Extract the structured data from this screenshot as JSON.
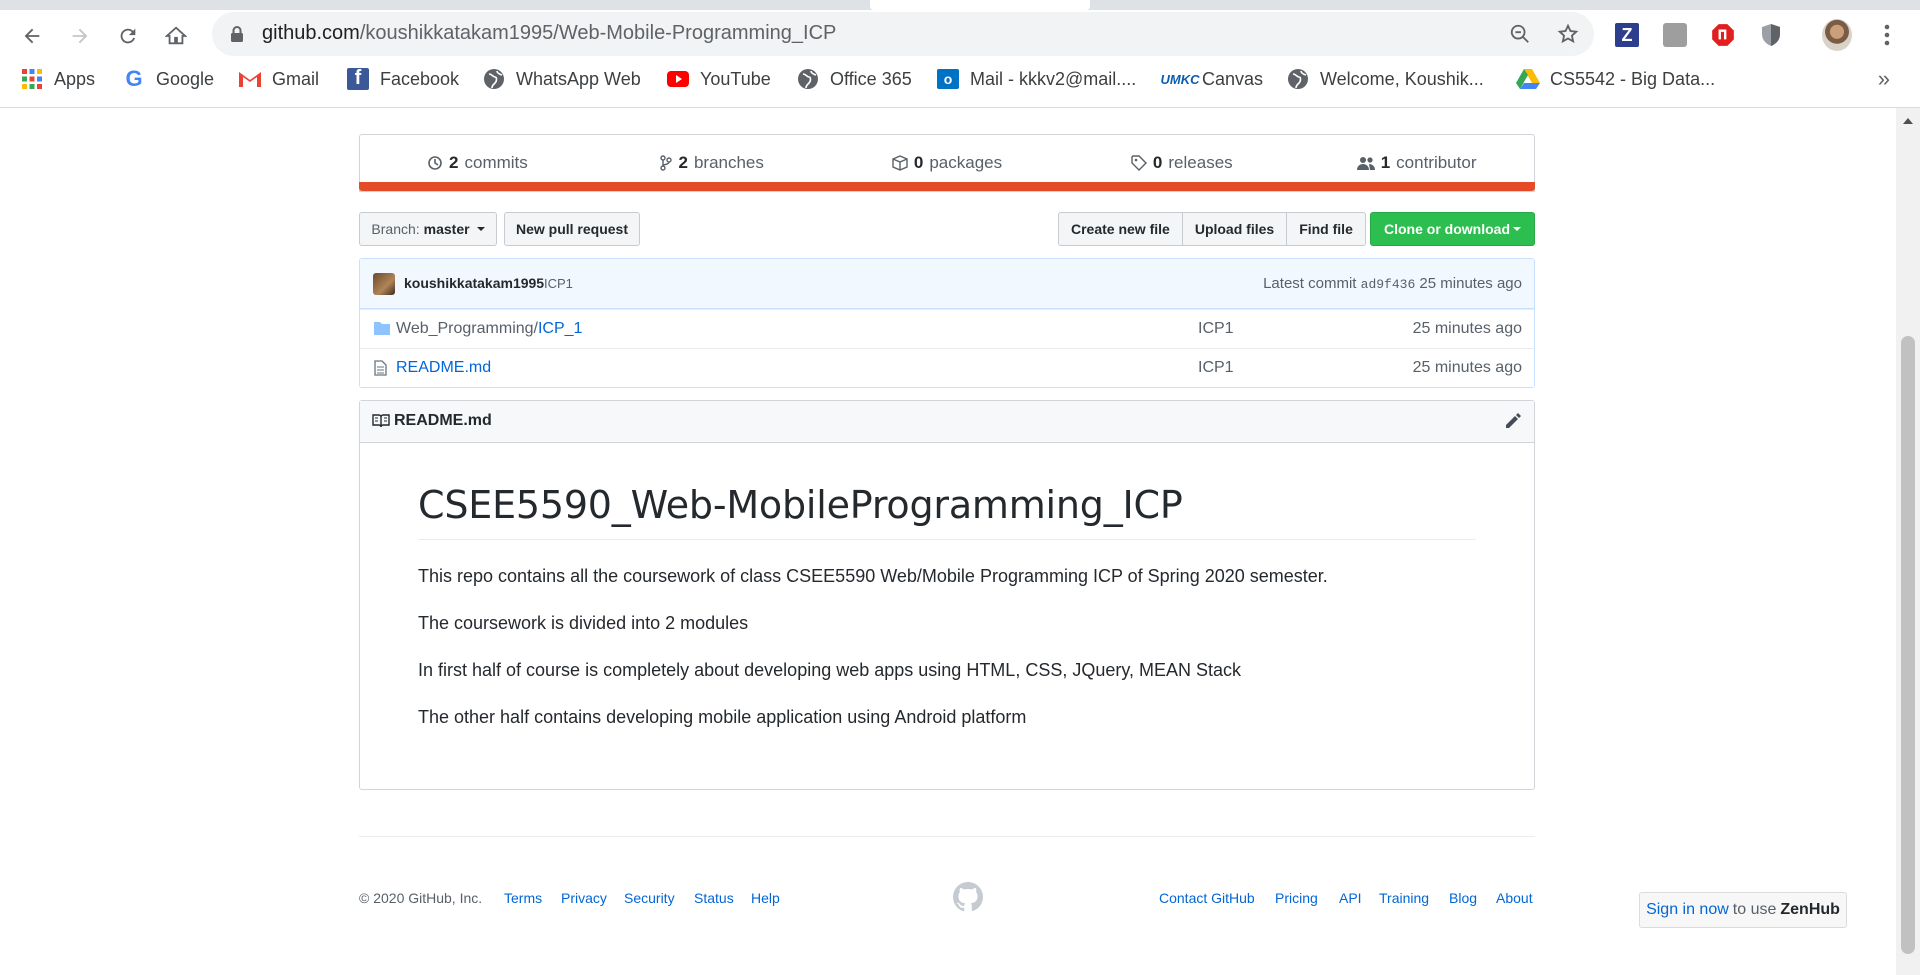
{
  "browser": {
    "url_domain": "github.com",
    "url_path": "/koushikkatakam1995/Web-Mobile-Programming_ICP",
    "bookmarks": [
      {
        "label": "Apps",
        "icon": "apps-grid-icon"
      },
      {
        "label": "Google",
        "icon": "google-icon"
      },
      {
        "label": "Gmail",
        "icon": "gmail-icon"
      },
      {
        "label": "Facebook",
        "icon": "facebook-icon"
      },
      {
        "label": "WhatsApp Web",
        "icon": "globe-icon"
      },
      {
        "label": "YouTube",
        "icon": "youtube-icon"
      },
      {
        "label": "Office 365",
        "icon": "globe-icon"
      },
      {
        "label": "Mail - kkkv2@mail....",
        "icon": "outlook-icon"
      },
      {
        "label": "Canvas",
        "icon": "umkc-icon"
      },
      {
        "label": "Welcome, Koushik...",
        "icon": "globe-icon"
      },
      {
        "label": "CS5542 - Big Data...",
        "icon": "google-drive-icon"
      }
    ],
    "bookmarks_overflow": "»"
  },
  "repo": {
    "numbers": [
      {
        "count": "2",
        "label": "commits"
      },
      {
        "count": "2",
        "label": "branches"
      },
      {
        "count": "0",
        "label": "packages"
      },
      {
        "count": "0",
        "label": "releases"
      },
      {
        "count": "1",
        "label": "contributor"
      }
    ],
    "lang_color": "#e34c26",
    "branch_prefix": "Branch:",
    "branch_name": "master",
    "new_pr": "New pull request",
    "create_file": "Create new file",
    "upload_files": "Upload files",
    "find_file": "Find file",
    "clone": "Clone or download"
  },
  "commit": {
    "author": "koushikkatakam1995",
    "message": "ICP1",
    "latest_label": "Latest commit",
    "sha": "ad9f436",
    "age": "25 minutes ago"
  },
  "files": [
    {
      "dir": "Web_Programming/",
      "name": "ICP_1",
      "message": "ICP1",
      "age": "25 minutes ago",
      "type": "folder"
    },
    {
      "dir": "",
      "name": "README.md",
      "message": "ICP1",
      "age": "25 minutes ago",
      "type": "file"
    }
  ],
  "readme": {
    "filename": "README.md",
    "heading": "CSEE5590_Web-MobileProgramming_ICP",
    "paragraphs": [
      "This repo contains all the coursework of class CSEE5590 Web/Mobile Programming ICP of Spring 2020 semester.",
      "The coursework is divided into 2 modules",
      "In first half of course is completely about developing web apps using HTML, CSS, JQuery, MEAN Stack",
      "The other half contains developing mobile application using Android platform"
    ]
  },
  "footer": {
    "copyright": "© 2020 GitHub, Inc.",
    "left_links": [
      "Terms",
      "Privacy",
      "Security",
      "Status",
      "Help"
    ],
    "right_links": [
      "Contact GitHub",
      "Pricing",
      "API",
      "Training",
      "Blog",
      "About"
    ]
  },
  "zenhub": {
    "link": "Sign in now",
    "mid": "to use",
    "brand": "ZenHub"
  }
}
